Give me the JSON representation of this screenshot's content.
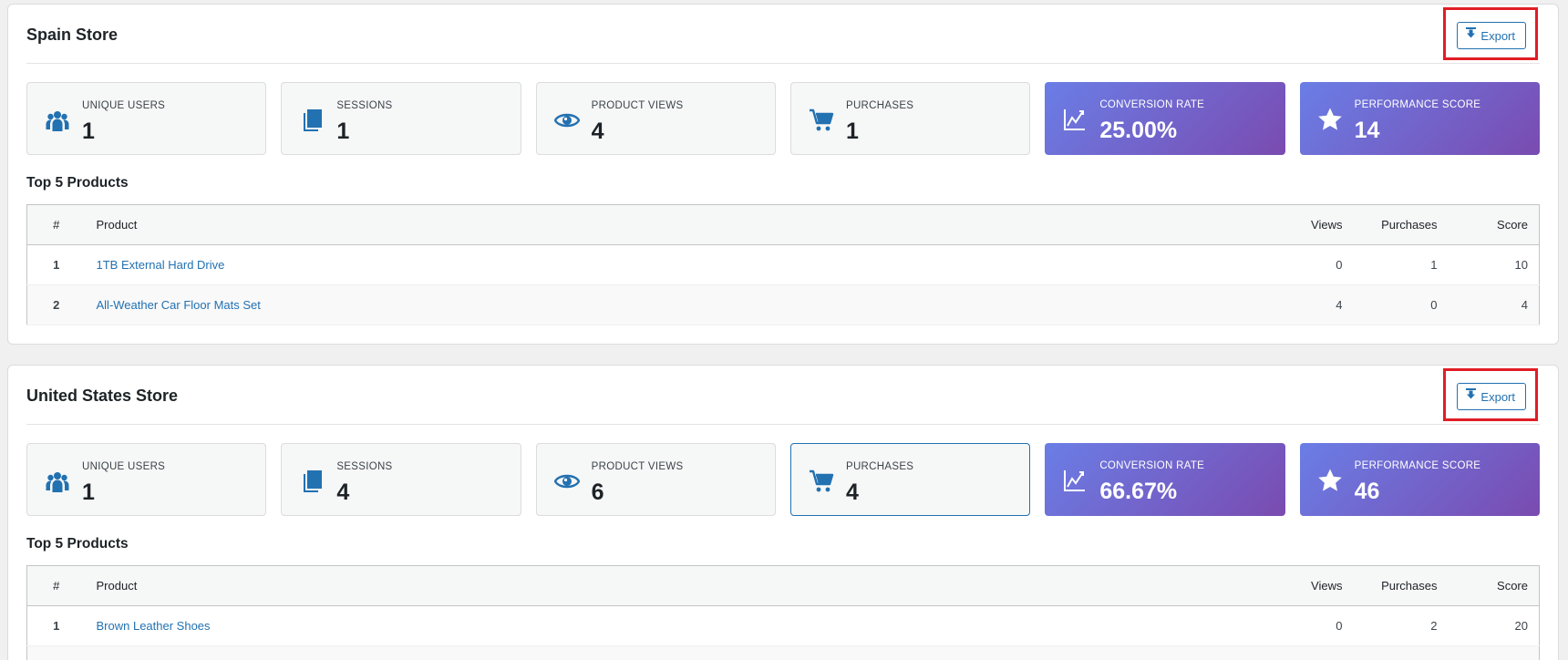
{
  "stores": [
    {
      "title": "Spain Store",
      "export_label": "Export",
      "stats": [
        {
          "label": "UNIQUE USERS",
          "value": "1",
          "icon": "users-icon"
        },
        {
          "label": "SESSIONS",
          "value": "1",
          "icon": "sessions-icon"
        },
        {
          "label": "PRODUCT VIEWS",
          "value": "4",
          "icon": "eye-icon"
        },
        {
          "label": "PURCHASES",
          "value": "1",
          "icon": "cart-icon"
        },
        {
          "label": "CONVERSION RATE",
          "value": "25.00%",
          "icon": "chart-line-icon"
        },
        {
          "label": "PERFORMANCE SCORE",
          "value": "14",
          "icon": "star-icon"
        }
      ],
      "products_title": "Top 5 Products",
      "table_headers": {
        "rank": "#",
        "product": "Product",
        "views": "Views",
        "purchases": "Purchases",
        "score": "Score"
      },
      "products": [
        {
          "rank": "1",
          "name": "1TB External Hard Drive",
          "views": "0",
          "purchases": "1",
          "score": "10"
        },
        {
          "rank": "2",
          "name": "All-Weather Car Floor Mats Set",
          "views": "4",
          "purchases": "0",
          "score": "4"
        }
      ]
    },
    {
      "title": "United States Store",
      "export_label": "Export",
      "stats": [
        {
          "label": "UNIQUE USERS",
          "value": "1",
          "icon": "users-icon"
        },
        {
          "label": "SESSIONS",
          "value": "4",
          "icon": "sessions-icon"
        },
        {
          "label": "PRODUCT VIEWS",
          "value": "6",
          "icon": "eye-icon"
        },
        {
          "label": "PURCHASES",
          "value": "4",
          "icon": "cart-icon"
        },
        {
          "label": "CONVERSION RATE",
          "value": "66.67%",
          "icon": "chart-line-icon"
        },
        {
          "label": "PERFORMANCE SCORE",
          "value": "46",
          "icon": "star-icon"
        }
      ],
      "products_title": "Top 5 Products",
      "table_headers": {
        "rank": "#",
        "product": "Product",
        "views": "Views",
        "purchases": "Purchases",
        "score": "Score"
      },
      "products": [
        {
          "rank": "1",
          "name": "Brown Leather Shoes",
          "views": "0",
          "purchases": "2",
          "score": "20"
        }
      ]
    }
  ],
  "colors": {
    "accent": "#2271b1",
    "highlight": "#e11d25",
    "gradient_start": "#6a7ee6",
    "gradient_end": "#7a4bb0"
  }
}
